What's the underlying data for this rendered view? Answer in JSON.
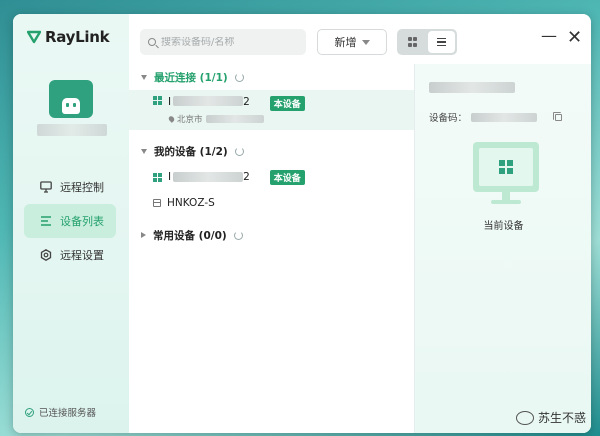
{
  "app": {
    "logo_text": "RayLink"
  },
  "sidebar": {
    "user_name": "",
    "items": [
      {
        "label": "远程控制",
        "icon": "monitor-icon",
        "active": false
      },
      {
        "label": "设备列表",
        "icon": "list-icon",
        "active": true
      },
      {
        "label": "远程设置",
        "icon": "settings-icon",
        "active": false
      }
    ],
    "status": "已连接服务器"
  },
  "toolbar": {
    "search_placeholder": "搜索设备码/名称",
    "add_label": "新增"
  },
  "groups": {
    "recent": {
      "title": "最近连接 (1/1)"
    },
    "mine": {
      "title": "我的设备 (1/2)"
    },
    "common": {
      "title": "常用设备 (0/0)"
    }
  },
  "devices": {
    "recent_1": {
      "name_prefix": "I",
      "name_suffix": "2",
      "badge": "本设备",
      "location": "北京市"
    },
    "mine_1": {
      "name_prefix": "I",
      "name_suffix": "2",
      "badge": "本设备"
    },
    "mine_2": {
      "name": "HNKOZ-S"
    }
  },
  "detail": {
    "code_label": "设备码：",
    "current_label": "当前设备"
  },
  "watermark": "苏生不惑",
  "colors": {
    "accent": "#25a16d",
    "sidebar_bg": "#e4f6f1"
  }
}
